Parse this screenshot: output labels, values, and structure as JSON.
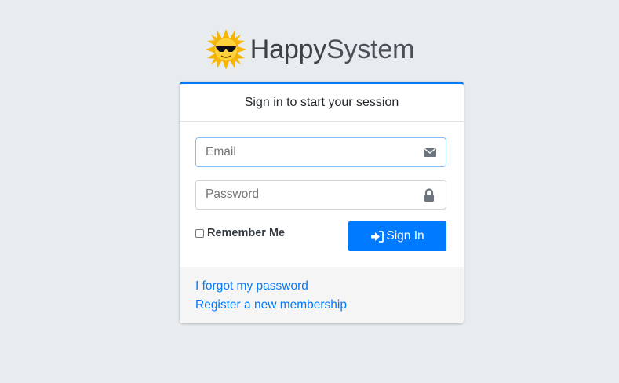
{
  "brand": {
    "name_bold": "Happy",
    "name_rest": "System",
    "logo_icon": "sun-with-sunglasses-icon"
  },
  "login": {
    "header": "Sign in to start your session",
    "email": {
      "placeholder": "Email",
      "value": "",
      "icon": "envelope-icon"
    },
    "password": {
      "placeholder": "Password",
      "value": "",
      "icon": "lock-icon"
    },
    "remember_label": "Remember Me",
    "remember_checked": false,
    "signin_label": "Sign In",
    "signin_icon": "sign-in-icon"
  },
  "links": {
    "forgot": "I forgot my password",
    "register": "Register a new membership"
  },
  "colors": {
    "accent": "#007bff",
    "background": "#e9ecef",
    "footer_bg": "#f5f5f5"
  }
}
